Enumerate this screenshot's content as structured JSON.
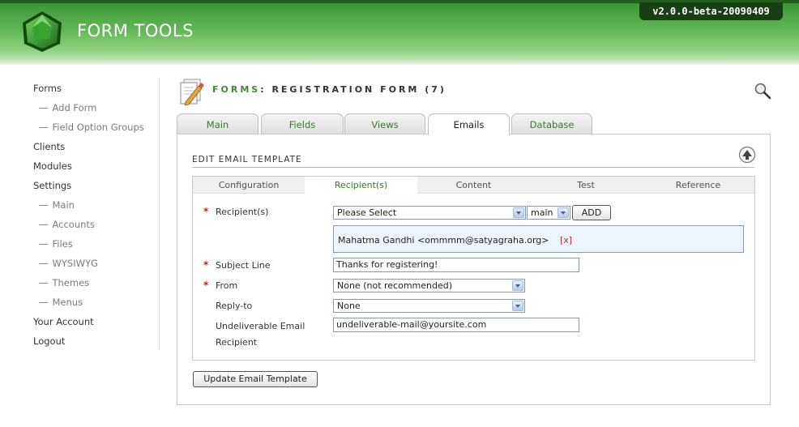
{
  "app": {
    "brand": "FORM TOOLS",
    "version": "v2.0.0-beta-20090409"
  },
  "nav": {
    "forms": "Forms",
    "add_form": "Add Form",
    "field_option_groups": "Field Option Groups",
    "clients": "Clients",
    "modules": "Modules",
    "settings": "Settings",
    "settings_main": "Main",
    "settings_accounts": "Accounts",
    "settings_files": "Files",
    "settings_wysiwyg": "WYSIWYG",
    "settings_themes": "Themes",
    "settings_menus": "Menus",
    "your_account": "Your Account",
    "logout": "Logout",
    "sub_dash": "—"
  },
  "page": {
    "title_prefix": "FORMS",
    "title_rest": ": REGISTRATION FORM (7)"
  },
  "tabs": [
    "Main",
    "Fields",
    "Views",
    "Emails",
    "Database"
  ],
  "active_tab": "Emails",
  "section_title": "EDIT EMAIL TEMPLATE",
  "subtabs": [
    "Configuration",
    "Recipient(s)",
    "Content",
    "Test",
    "Reference"
  ],
  "active_subtab": "Recipient(s)",
  "form": {
    "recipients_label": "Recipient(s)",
    "recipient_select": "Please Select",
    "recipient_type_select": "main",
    "add_button": "ADD",
    "recipient_entry": "Mahatma Gandhi <ommmm@satyagraha.org>",
    "remove_marker": "[x]",
    "subject_label": "Subject Line",
    "subject_value": "Thanks for registering!",
    "from_label": "From",
    "from_value": "None (not recommended)",
    "replyto_label": "Reply-to",
    "replyto_value": "None",
    "undeliverable_label_1": "Undeliverable Email",
    "undeliverable_label_2": "Recipient",
    "undeliverable_value": "undeliverable-mail@yoursite.com",
    "required_marker": "*"
  },
  "update_button": "Update Email Template",
  "colors": {
    "brand_green": "#3a8d2e",
    "required": "#c81e1e",
    "header_dark": "#163f12"
  },
  "icons": {
    "logo": "form-tools-logo",
    "title": "forms-page-icon",
    "search": "search-icon",
    "collapse": "collapse-up-icon"
  }
}
